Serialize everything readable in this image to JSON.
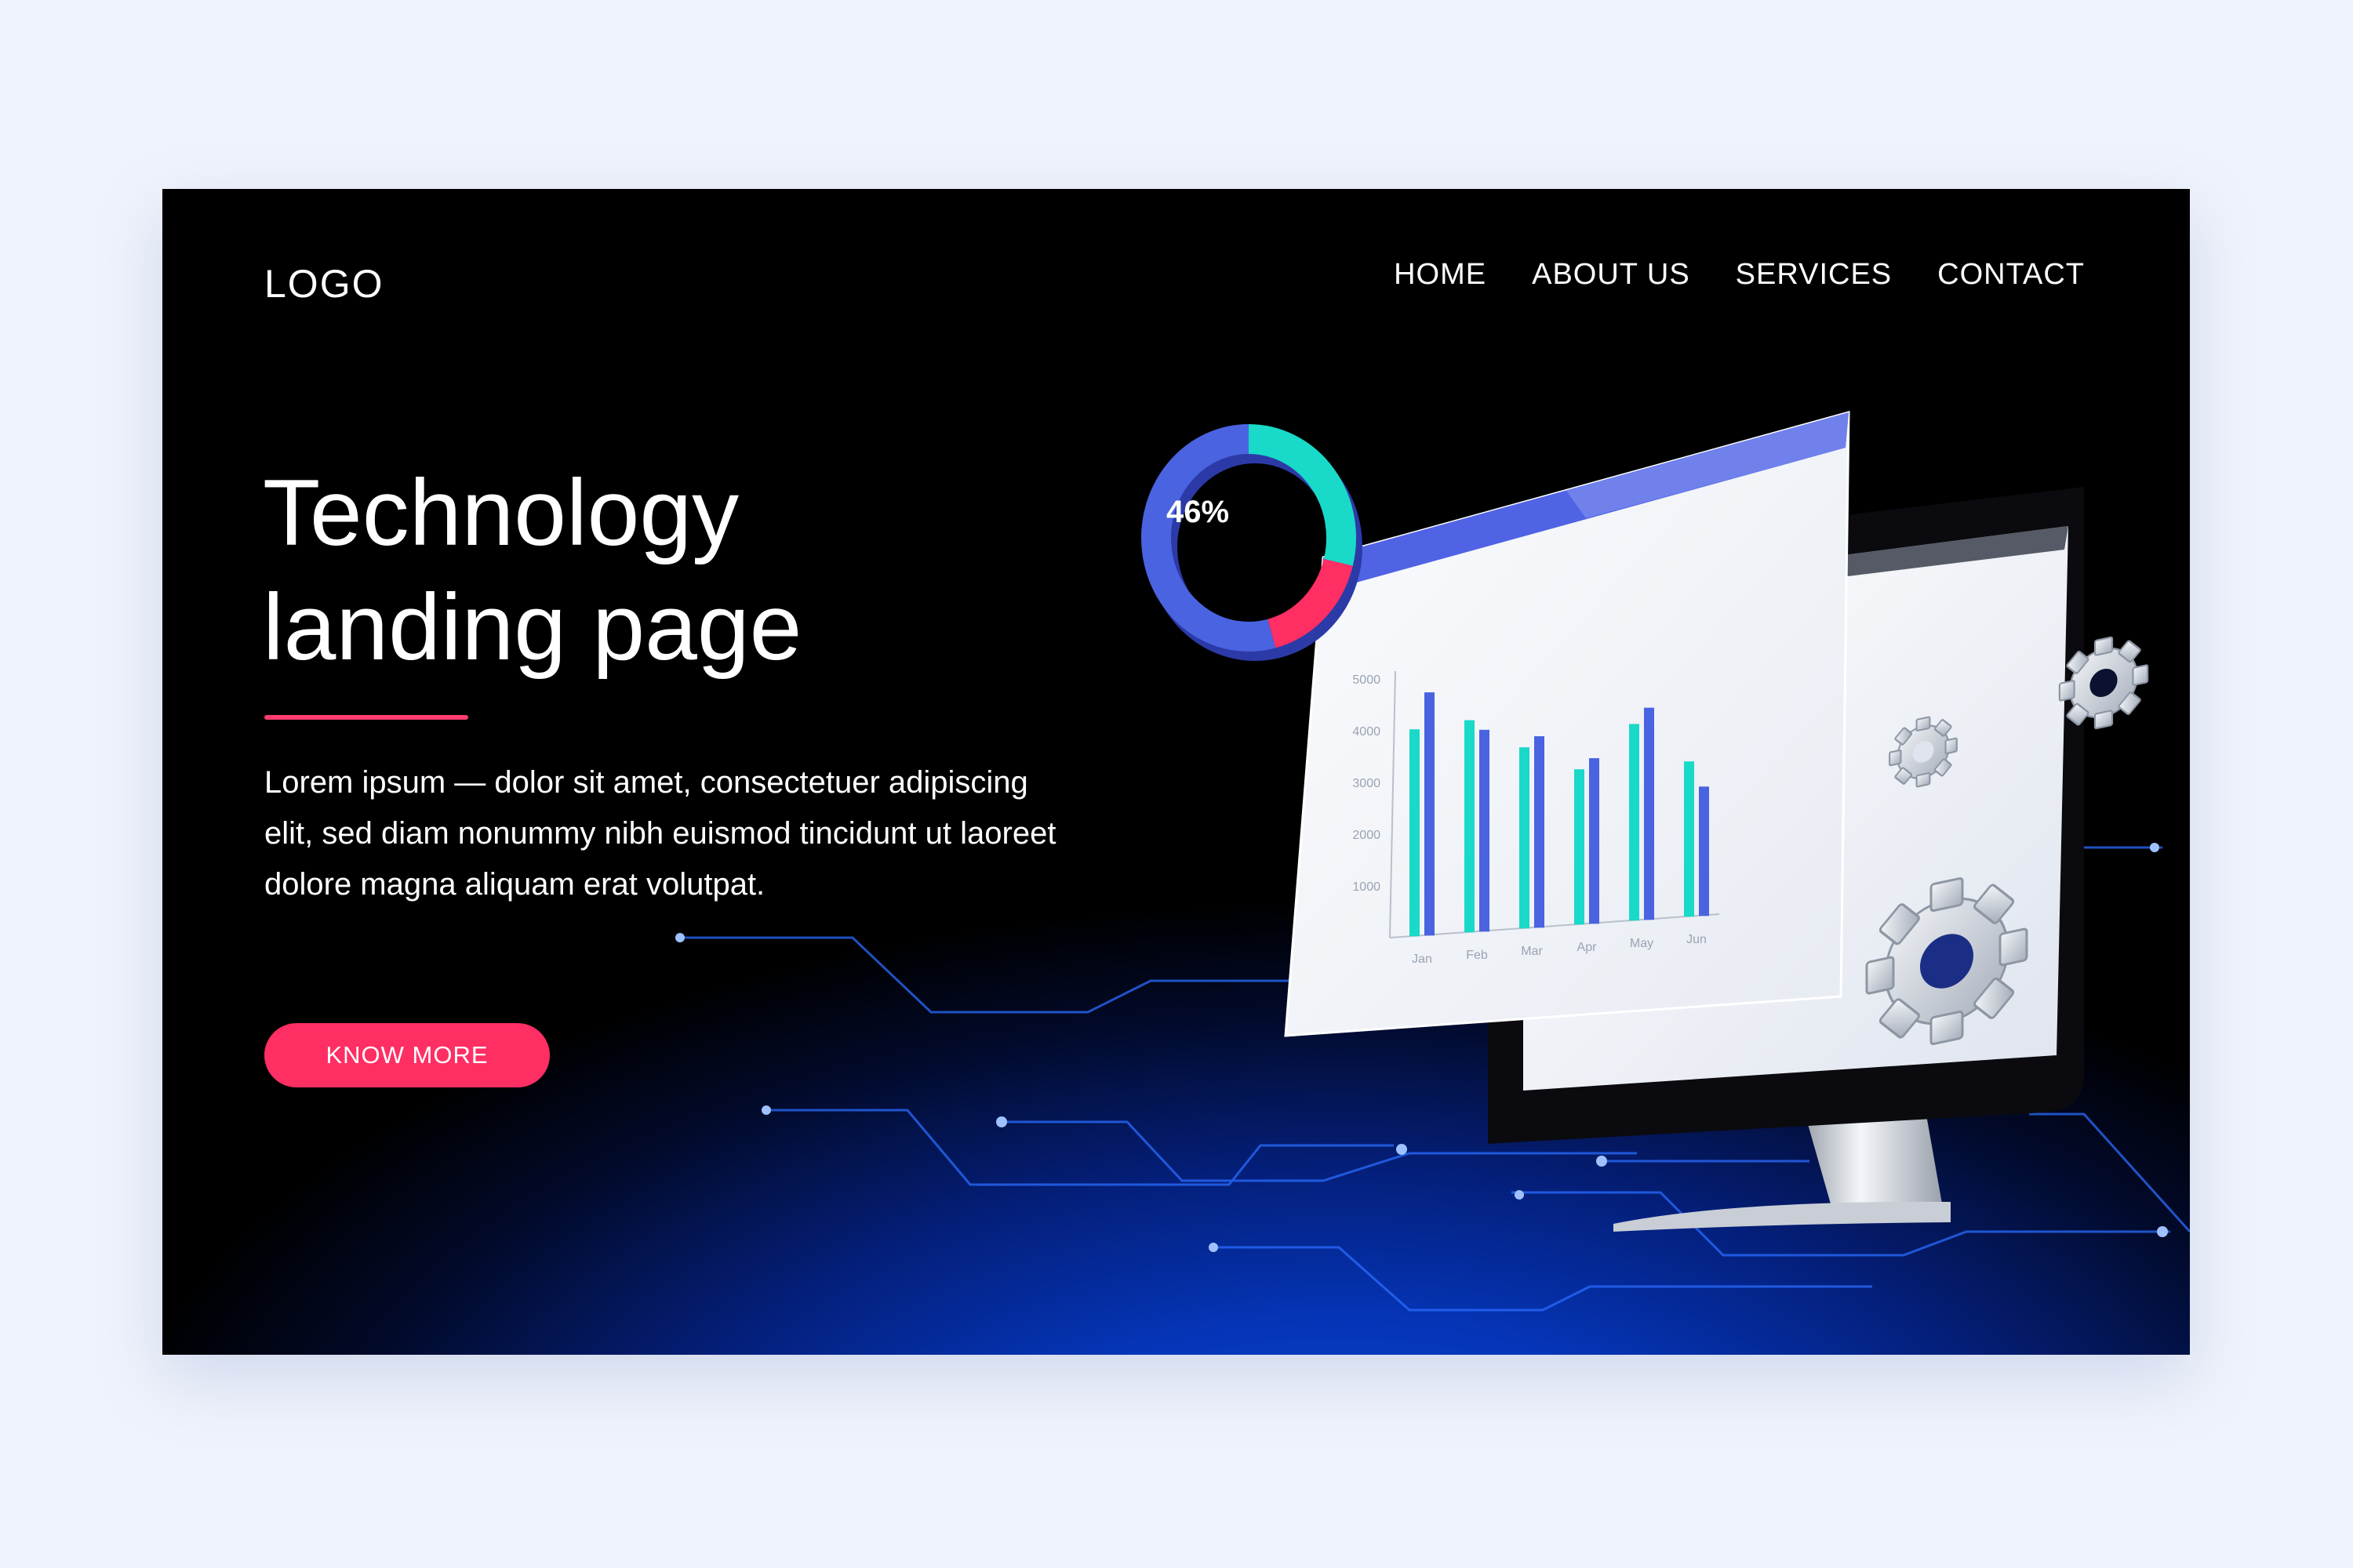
{
  "header": {
    "logo": "LOGO",
    "nav": [
      "HOME",
      "ABOUT US",
      "SERVICES",
      "CONTACT"
    ]
  },
  "hero": {
    "title_line1": "Technology",
    "title_line2": "landing page",
    "description": "Lorem ipsum — dolor sit amet, consectetuer adipiscing elit, sed diam nonummy nibh euismod tincidunt ut laoreet dolore magna aliquam erat volutpat.",
    "cta_label": "KNOW MORE"
  },
  "donut": {
    "label": "46%",
    "value": 46
  },
  "colors": {
    "accent": "#ff2e63",
    "blue": "#4a63e0",
    "teal": "#19d9c8"
  },
  "chart_data": {
    "type": "bar",
    "categories": [
      "Jan",
      "Feb",
      "Mar",
      "Apr",
      "May",
      "Jun"
    ],
    "y_ticks": [
      "5000",
      "4000",
      "3000",
      "2000",
      "1000"
    ],
    "series": [
      {
        "values": [
          4000,
          4100,
          3500,
          3000,
          3800,
          3000
        ]
      },
      {
        "values": [
          4700,
          3900,
          3700,
          3200,
          4100,
          2500
        ]
      }
    ],
    "ylim": [
      0,
      5000
    ]
  }
}
